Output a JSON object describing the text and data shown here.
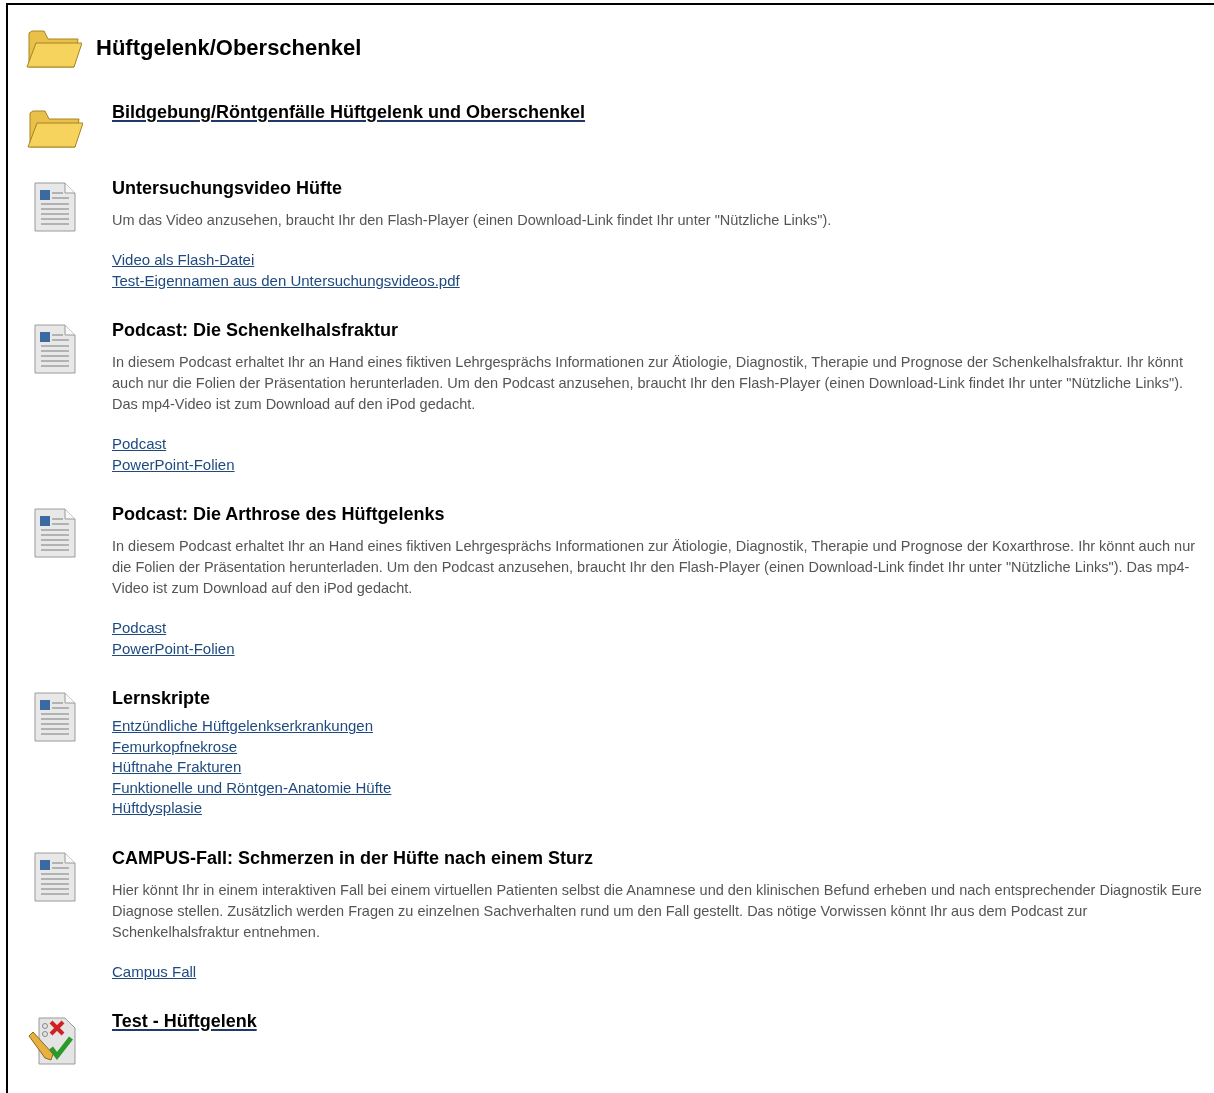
{
  "header": {
    "title": "Hüftgelenk/Oberschenkel"
  },
  "items": [
    {
      "kind": "folder",
      "title": "Bildgebung/Röntgenfälle Hüftgelenk und Oberschenkel"
    },
    {
      "kind": "document",
      "title": "Untersuchungsvideo Hüfte",
      "description": "Um das Video anzusehen, braucht Ihr den Flash-Player (einen Download-Link findet Ihr unter \"Nützliche Links\").",
      "links": [
        "Video als Flash-Datei",
        "Test-Eigennamen aus den Untersuchungsvideos.pdf"
      ]
    },
    {
      "kind": "document",
      "title": "Podcast: Die Schenkelhalsfraktur",
      "description": "In diesem Podcast erhaltet Ihr an Hand eines fiktiven Lehrgesprächs Informationen zur Ätiologie, Diagnostik, Therapie und Prognose der Schenkelhalsfraktur. Ihr könnt auch nur die Folien der Präsentation herunterladen. Um den Podcast anzusehen, braucht Ihr den Flash-Player (einen Download-Link findet Ihr unter \"Nützliche Links\"). Das mp4-Video ist zum Download auf den iPod gedacht.",
      "links": [
        "Podcast",
        "PowerPoint-Folien"
      ]
    },
    {
      "kind": "document",
      "title": "Podcast: Die Arthrose des Hüftgelenks",
      "description": "In diesem Podcast erhaltet Ihr an Hand eines fiktiven Lehrgesprächs Informationen zur Ätiologie, Diagnostik, Therapie und Prognose der Koxarthrose. Ihr könnt auch nur die Folien der Präsentation herunterladen. Um den Podcast anzusehen, braucht Ihr den Flash-Player (einen Download-Link findet Ihr unter \"Nützliche Links\"). Das mp4-Video ist zum Download auf den iPod gedacht.",
      "links": [
        "Podcast",
        "PowerPoint-Folien"
      ]
    },
    {
      "kind": "document",
      "title": "Lernskripte",
      "links": [
        "Entzündliche Hüftgelenkserkrankungen",
        "Femurkopfnekrose",
        "Hüftnahe Frakturen",
        "Funktionelle und Röntgen-Anatomie Hüfte",
        "Hüftdysplasie"
      ]
    },
    {
      "kind": "document",
      "title": "CAMPUS-Fall: Schmerzen in der Hüfte nach einem Sturz",
      "description": "Hier könnt Ihr in einem interaktiven Fall bei einem virtuellen Patienten selbst die Anamnese und den klinischen Befund erheben und nach entsprechender Diagnostik Eure Diagnose stellen. Zusätzlich werden Fragen zu einzelnen Sachverhalten rund um den Fall gestellt. Das nötige Vorwissen könnt Ihr aus dem Podcast zur Schenkelhalsfraktur entnehmen.",
      "links": [
        "Campus Fall"
      ]
    },
    {
      "kind": "test",
      "title": "Test - Hüftgelenk"
    }
  ]
}
